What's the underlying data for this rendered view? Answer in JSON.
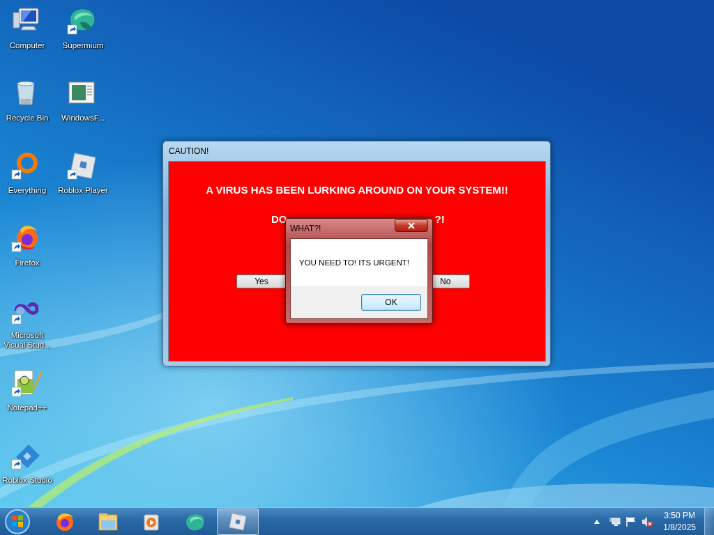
{
  "desktop_icons": [
    [
      {
        "label": "Computer",
        "shortcut": false
      },
      {
        "label": "Supermium",
        "shortcut": true
      }
    ],
    [
      {
        "label": "Recycle Bin",
        "shortcut": false
      },
      {
        "label": "WindowsF...",
        "shortcut": false
      }
    ],
    [
      {
        "label": "Everything",
        "shortcut": true
      },
      {
        "label": "Roblox Player",
        "shortcut": true
      }
    ],
    [
      {
        "label": "Firefox",
        "shortcut": true
      }
    ],
    [
      {
        "label": "Microsoft Visual Stud...",
        "shortcut": true
      }
    ],
    [
      {
        "label": "Notepad++",
        "shortcut": true
      }
    ],
    [
      {
        "label": "Roblox Studio",
        "shortcut": true
      }
    ]
  ],
  "window": {
    "title": "CAUTION!",
    "heading": "A VIRUS HAS BEEN LURKING AROUND ON YOUR SYSTEM!!",
    "question_parts": [
      "DO",
      "?!"
    ],
    "buttons": [
      "Yes",
      "No"
    ]
  },
  "dialog": {
    "title": "WHAT?!",
    "message": "YOU NEED TO! ITS URGENT!",
    "button": "OK"
  },
  "taskbar": {
    "items": [
      {
        "selected": false
      },
      {
        "selected": false
      },
      {
        "selected": false
      },
      {
        "selected": false
      },
      {
        "selected": true
      }
    ],
    "tray": {
      "volume_muted": true,
      "time": "3:50 PM",
      "date": "1/8/2025"
    }
  }
}
